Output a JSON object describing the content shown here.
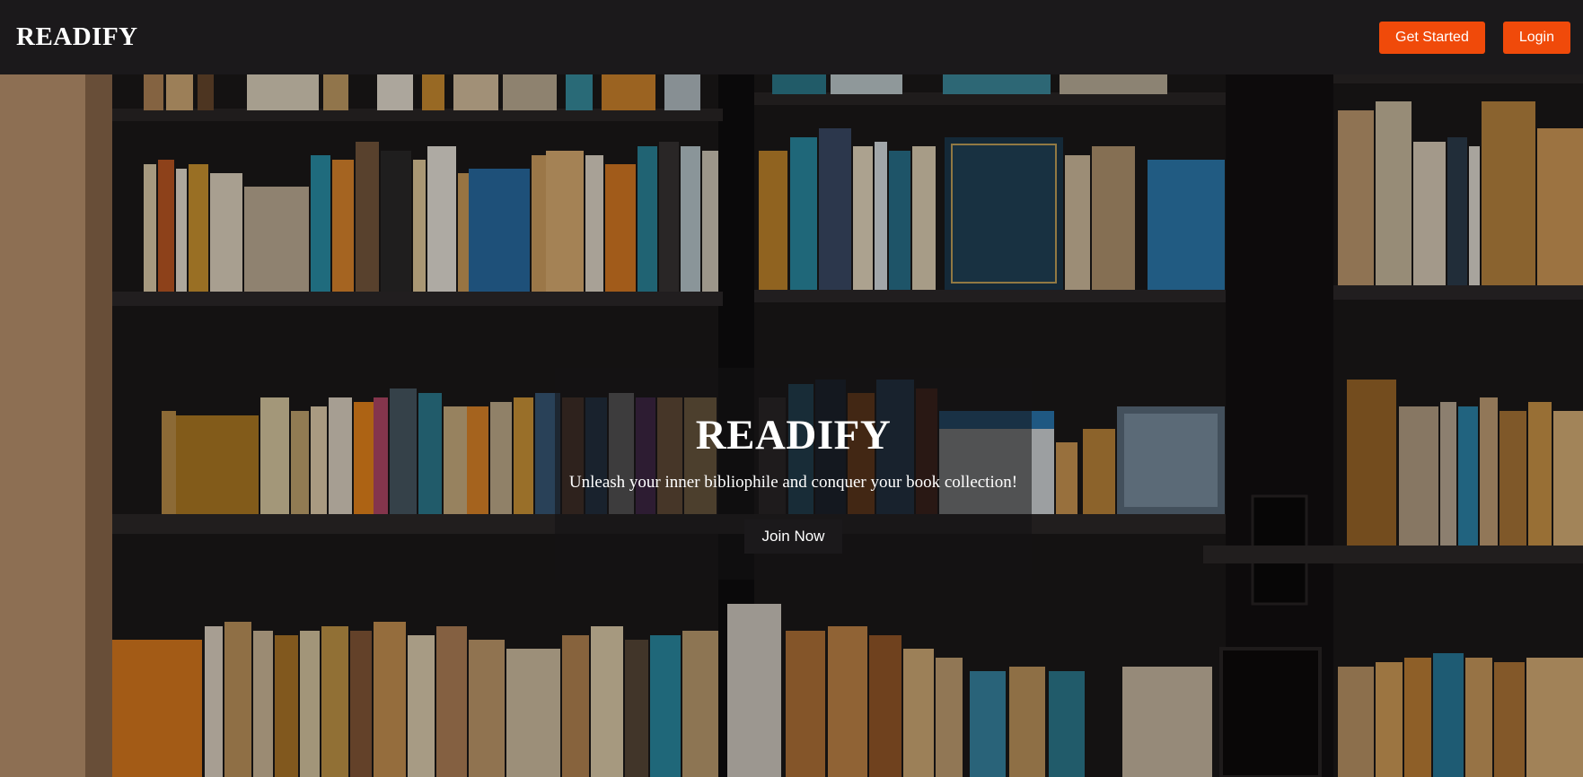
{
  "navbar": {
    "brand": "READIFY",
    "get_started_label": "Get Started",
    "login_label": "Login"
  },
  "hero": {
    "background": "bookshelf-photo",
    "title": "READIFY",
    "subtitle": "Unleash your inner bibliophile and conquer your book collection!",
    "join_label": "Join Now"
  },
  "colors": {
    "navbar_bg": "#1b191b",
    "accent": "#f04a0a",
    "text": "#ffffff"
  }
}
